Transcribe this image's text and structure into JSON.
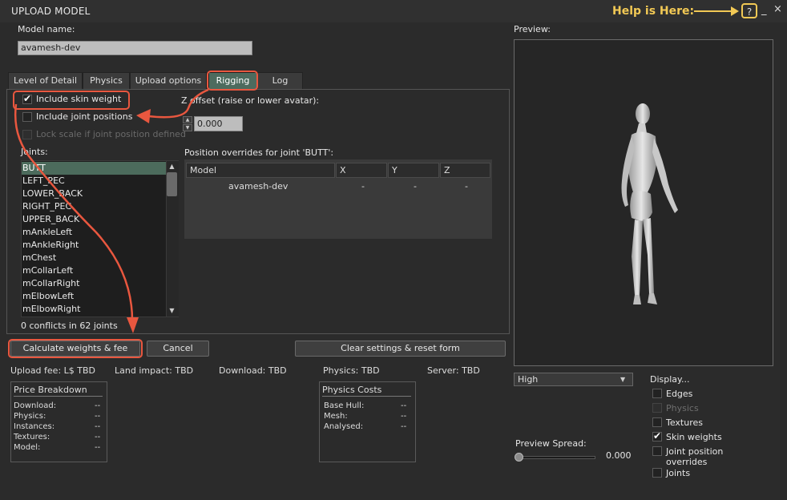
{
  "window": {
    "title": "UPLOAD MODEL",
    "help_hint": "Help is Here:",
    "help_button": "?",
    "minimize_button": "_",
    "close_button": "×"
  },
  "model_name": {
    "label": "Model name:",
    "value": "avamesh-dev"
  },
  "tabs": [
    {
      "label": "Level of Detail",
      "active": false
    },
    {
      "label": "Physics",
      "active": false
    },
    {
      "label": "Upload options",
      "active": false
    },
    {
      "label": "Rigging",
      "active": true
    },
    {
      "label": "Log",
      "active": false
    }
  ],
  "rigging": {
    "include_skin_weight": {
      "label": "Include skin weight",
      "checked": true
    },
    "include_joint_positions": {
      "label": "Include joint positions",
      "checked": false
    },
    "lock_scale": {
      "label": "Lock scale if joint position defined",
      "checked": false,
      "enabled": false
    },
    "z_offset_label": "Z offset (raise or lower avatar):",
    "z_offset_value": "0.000",
    "joints_label": "Joints:",
    "joints": [
      "BUTT",
      "LEFT_PEC",
      "LOWER_BACK",
      "RIGHT_PEC",
      "UPPER_BACK",
      "mAnkleLeft",
      "mAnkleRight",
      "mChest",
      "mCollarLeft",
      "mCollarRight",
      "mElbowLeft",
      "mElbowRight"
    ],
    "selected_joint": "BUTT",
    "conflicts_text": "0 conflicts in 62 joints",
    "overrides_title": "Position overrides for joint 'BUTT':",
    "overrides_columns": [
      "Model",
      "X",
      "Y",
      "Z"
    ],
    "overrides_rows": [
      [
        "avamesh-dev",
        "-",
        "-",
        "-"
      ]
    ]
  },
  "buttons": {
    "calculate": "Calculate weights & fee",
    "cancel": "Cancel",
    "clear": "Clear settings & reset form"
  },
  "stats": {
    "upload_fee": "Upload fee: L$ TBD",
    "land_impact": "Land impact: TBD",
    "download": "Download: TBD",
    "physics": "Physics: TBD",
    "server": "Server: TBD"
  },
  "price_breakdown": {
    "title": "Price Breakdown",
    "rows": [
      [
        "Download:",
        "--"
      ],
      [
        "Physics:",
        "--"
      ],
      [
        "Instances:",
        "--"
      ],
      [
        "Textures:",
        "--"
      ],
      [
        "Model:",
        "--"
      ]
    ]
  },
  "physics_costs": {
    "title": "Physics Costs",
    "rows": [
      [
        "Base Hull:",
        "--"
      ],
      [
        "Mesh:",
        "--"
      ],
      [
        "Analysed:",
        "--"
      ]
    ]
  },
  "preview": {
    "label": "Preview:",
    "lod_select": "High",
    "spread_label": "Preview Spread:",
    "spread_value": "0.000",
    "spread_fraction": 0.0,
    "display_label": "Display...",
    "display_options": [
      {
        "label": "Edges",
        "checked": false,
        "enabled": true
      },
      {
        "label": "Physics",
        "checked": false,
        "enabled": false
      },
      {
        "label": "Textures",
        "checked": false,
        "enabled": true
      },
      {
        "label": "Skin weights",
        "checked": true,
        "enabled": true
      },
      {
        "label": "Joint position",
        "label2": "overrides",
        "checked": false,
        "enabled": true
      },
      {
        "label": "Joints",
        "checked": false,
        "enabled": true
      }
    ]
  },
  "colors": {
    "accent": "#4d6b5e",
    "annotation": "#e9573f",
    "help": "#f2c955"
  }
}
